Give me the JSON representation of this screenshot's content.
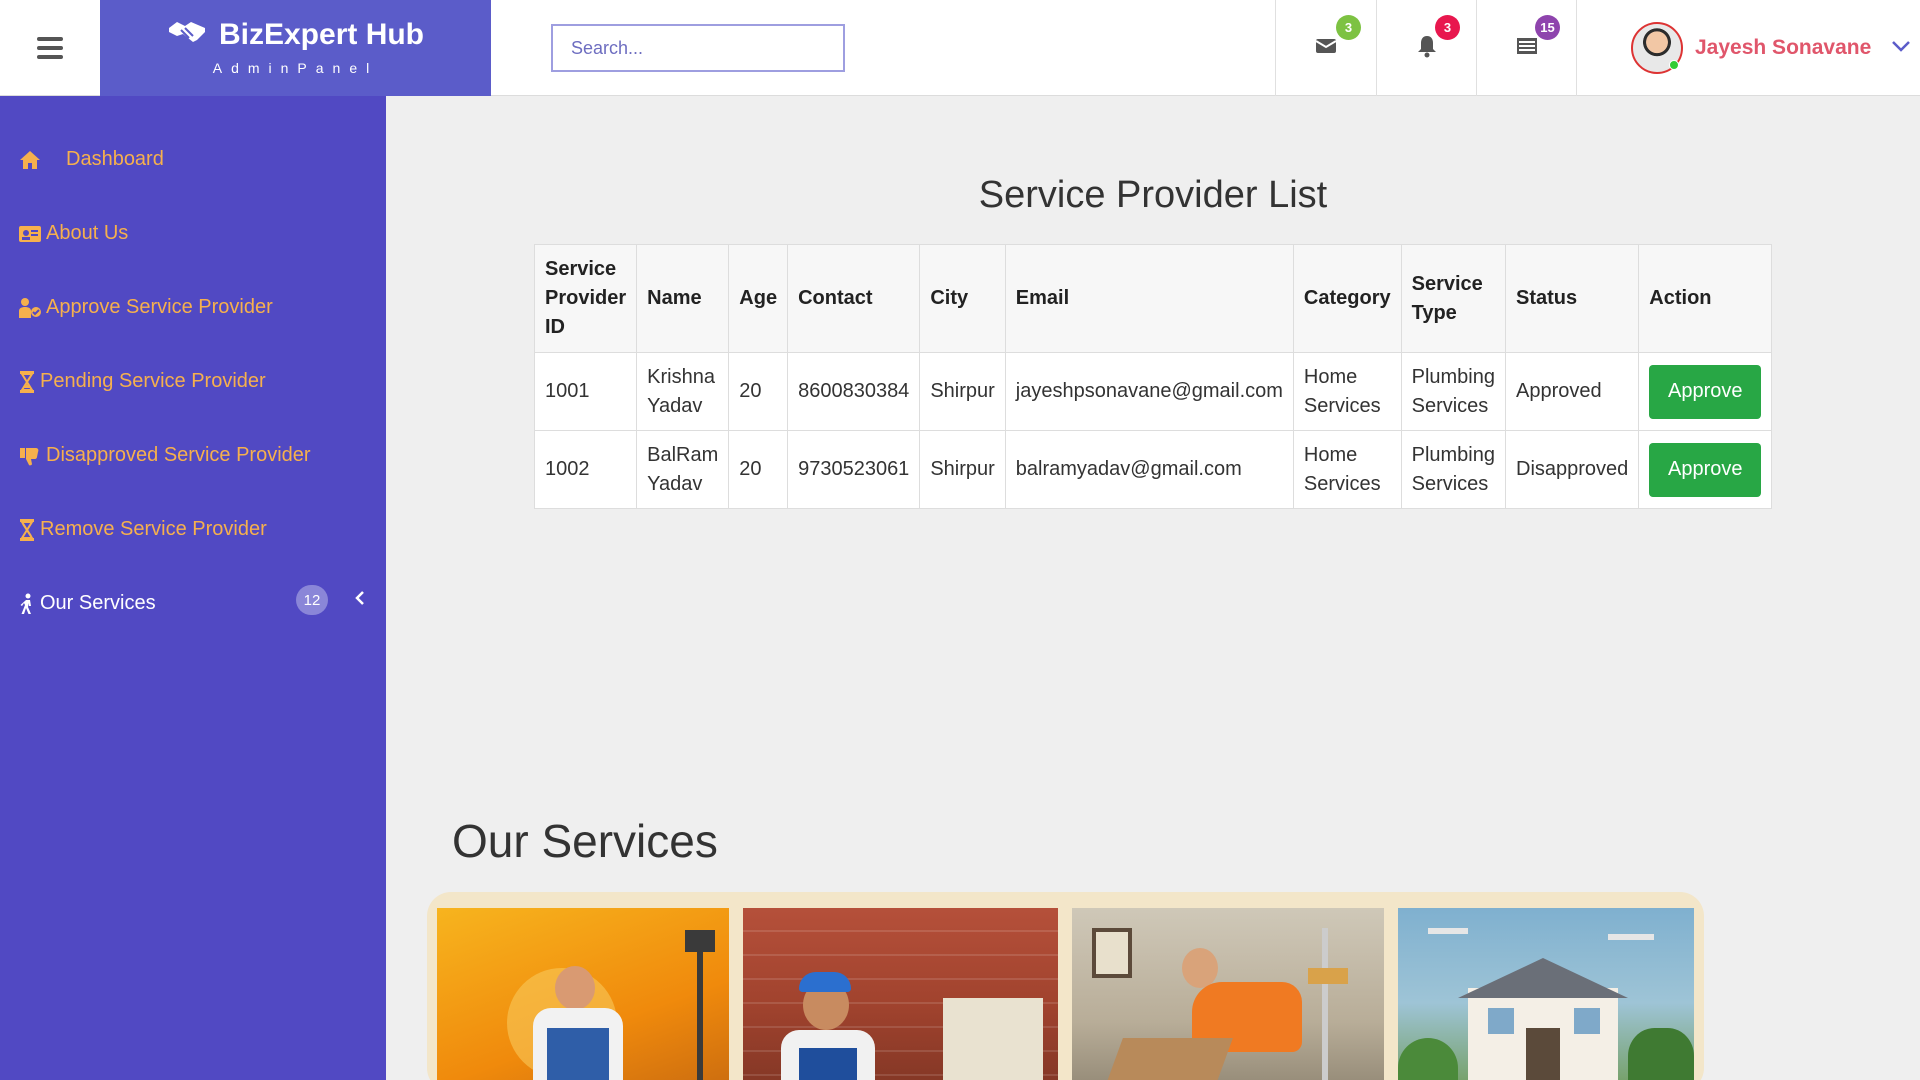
{
  "brand": {
    "title": "BizExpert Hub",
    "subtitle": "AdminPanel"
  },
  "search": {
    "placeholder": "Search..."
  },
  "header": {
    "messages_count": "3",
    "notifications_count": "3",
    "tasks_count": "15",
    "user_name": "Jayesh Sonavane"
  },
  "sidebar": {
    "items": [
      {
        "label": "Dashboard"
      },
      {
        "label": "About Us"
      },
      {
        "label": "Approve Service Provider"
      },
      {
        "label": "Pending Service Provider"
      },
      {
        "label": "Disapproved Service Provider"
      },
      {
        "label": "Remove Service Provider"
      },
      {
        "label": "Our Services",
        "count": "12"
      }
    ]
  },
  "main": {
    "title": "Service Provider List",
    "columns": [
      "Service Provider ID",
      "Name",
      "Age",
      "Contact",
      "City",
      "Email",
      "Category",
      "Service Type",
      "Status",
      "Action"
    ],
    "rows": [
      {
        "id": "1001",
        "name": "Krishna Yadav",
        "age": "20",
        "contact": "8600830384",
        "city": "Shirpur",
        "email": "jayeshpsonavane@gmail.com",
        "category": "Home Services",
        "service_type": "Plumbing Services",
        "status": "Approved",
        "action": "Approve"
      },
      {
        "id": "1002",
        "name": "BalRam Yadav",
        "age": "20",
        "contact": "9730523061",
        "city": "Shirpur",
        "email": "balramyadav@gmail.com",
        "category": "Home Services",
        "service_type": "Plumbing Services",
        "status": "Disapproved",
        "action": "Approve"
      }
    ],
    "services_title": "Our Services"
  },
  "colors": {
    "brand": "#5b5cc9",
    "sidebar": "#5149c3",
    "nav_text": "#f6b04d",
    "approve": "#28a745",
    "user_name": "#e0566b"
  }
}
